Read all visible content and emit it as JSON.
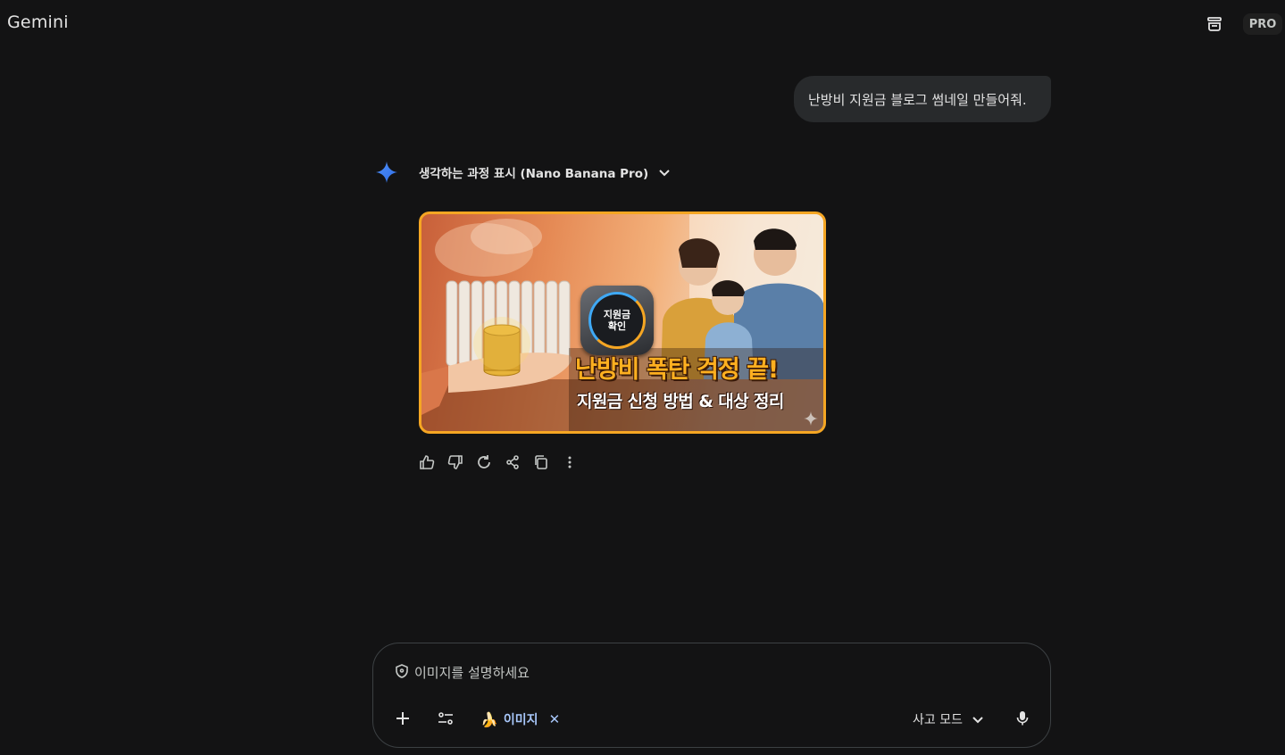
{
  "header": {
    "brand": "Gemini",
    "plan_badge": "PRO",
    "icons": [
      "temporary-chat-icon"
    ]
  },
  "conversation": {
    "user_message": "난방비 지원금 블로그 썸네일 만들어줘.",
    "thinking_label": "생각하는 과정 표시 (Nano Banana Pro)",
    "generated_image": {
      "badge_line1": "지원금",
      "badge_line2": "확인",
      "headline": "난방비 폭탄 걱정 끝!",
      "subline": "지원금 신청 방법 & 대상 정리"
    },
    "actions": [
      "thumbs-up-icon",
      "thumbs-down-icon",
      "regenerate-icon",
      "share-icon",
      "copy-icon",
      "more-vert-icon"
    ]
  },
  "composer": {
    "placeholder": "이미지를 설명하세요",
    "chip_label": "이미지",
    "mode_label": "사고 모드"
  },
  "colors": {
    "background": "#131314",
    "bubble": "#282a2c",
    "accent_blue": "#a8c7fa",
    "image_border": "#f5a623"
  }
}
